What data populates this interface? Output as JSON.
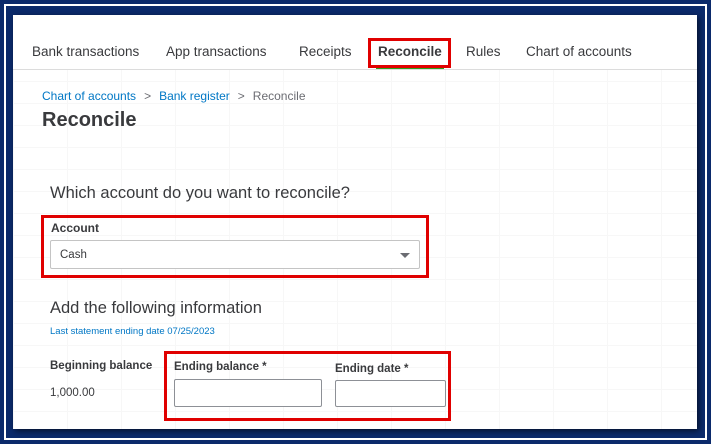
{
  "tabs": [
    {
      "label": "Bank transactions",
      "active": false
    },
    {
      "label": "App transactions",
      "active": false
    },
    {
      "label": "Receipts",
      "active": false
    },
    {
      "label": "Reconcile",
      "active": true
    },
    {
      "label": "Rules",
      "active": false
    },
    {
      "label": "Chart of accounts",
      "active": false
    }
  ],
  "breadcrumb": {
    "items": [
      "Chart of accounts",
      "Bank register"
    ],
    "separator": ">",
    "current": "Reconcile"
  },
  "page_title": "Reconcile",
  "account_section": {
    "question": "Which account do you want to reconcile?",
    "label": "Account",
    "selected_value": "Cash"
  },
  "info_section": {
    "heading": "Add the following information",
    "last_statement": "Last statement ending date 07/25/2023",
    "beginning_balance_label": "Beginning balance",
    "beginning_balance_value": "1,000.00",
    "ending_balance_label": "Ending balance *",
    "ending_balance_value": "",
    "ending_date_label": "Ending date *",
    "ending_date_value": ""
  },
  "colors": {
    "frame_background": "#0b2a6b",
    "highlight": "#e00000",
    "link": "#0077c5",
    "active_tab_underline": "#2ca01c"
  }
}
